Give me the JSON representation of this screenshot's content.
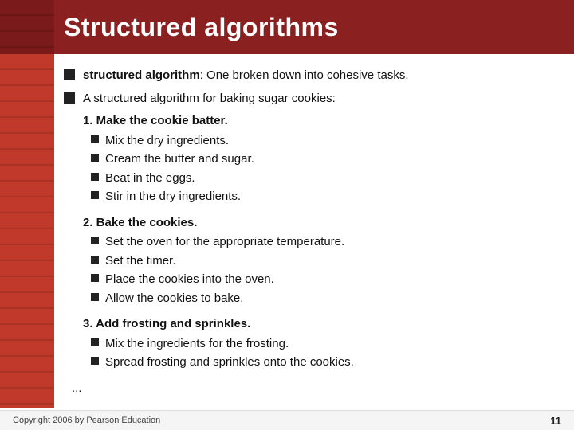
{
  "header": {
    "title": "Structured algorithms"
  },
  "bullet1": {
    "term": "structured algorithm",
    "definition": ": One broken down into cohesive tasks."
  },
  "bullet2": {
    "intro": "A structured algorithm for baking sugar cookies:",
    "sections": [
      {
        "title": "1. Make the cookie batter.",
        "items": [
          "Mix the dry ingredients.",
          "Cream the butter and sugar.",
          "Beat in the eggs.",
          "Stir in the dry ingredients."
        ]
      },
      {
        "title": "2. Bake the cookies.",
        "items": [
          "Set the oven for the appropriate temperature.",
          "Set the timer.",
          "Place the cookies into the oven.",
          "Allow the cookies to bake."
        ]
      },
      {
        "title": "3. Add frosting and sprinkles.",
        "items": [
          "Mix the ingredients for the frosting.",
          "Spread frosting and sprinkles onto the cookies."
        ]
      }
    ]
  },
  "ellipsis": "...",
  "footer": {
    "copyright": "Copyright 2006 by Pearson Education",
    "page": "11"
  }
}
